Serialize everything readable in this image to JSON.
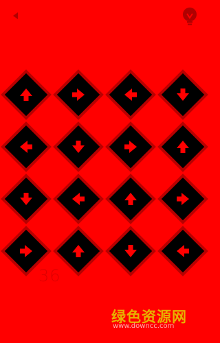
{
  "header": {
    "back_icon": "back-arrow-icon",
    "hint_icon": "lightbulb-icon"
  },
  "board": {
    "rows": [
      [
        "up",
        "right",
        "left",
        "down"
      ],
      [
        "left",
        "down",
        "right",
        "up"
      ],
      [
        "down",
        "left",
        "up",
        "right"
      ],
      [
        "right",
        "up",
        "down",
        "left"
      ]
    ]
  },
  "status": {
    "move_count": "36"
  },
  "watermark": {
    "site_name": "绿色资源网",
    "url": "www.downcc.com"
  },
  "colors": {
    "background": "#ff0000",
    "tile_fill": "#000000",
    "tile_border": "#b80000",
    "arrow": "#ff0000",
    "counter": "#dd0000",
    "watermark": "#e8b100"
  }
}
